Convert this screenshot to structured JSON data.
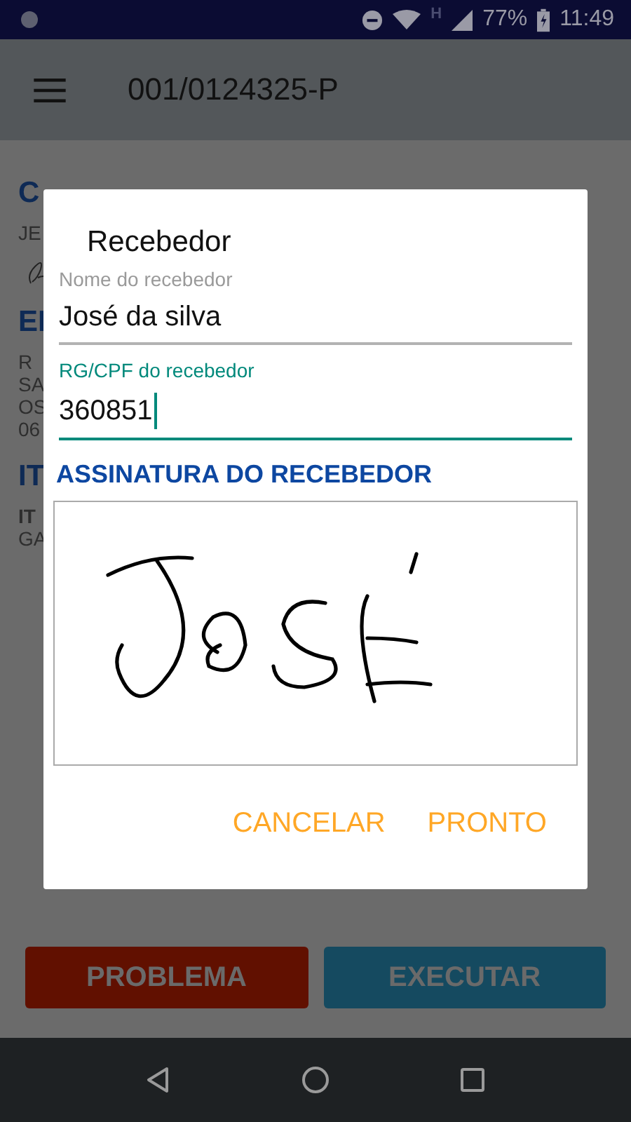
{
  "status_bar": {
    "network": "H",
    "battery": "77%",
    "time": "11:49"
  },
  "app_bar": {
    "title": "001/0124325-P"
  },
  "background": {
    "lines": [
      {
        "kind": "heading",
        "text": "C"
      },
      {
        "kind": "text",
        "text": "JE"
      },
      {
        "kind": "signature"
      },
      {
        "kind": "heading",
        "text": "EI"
      },
      {
        "kind": "text",
        "text": "R"
      },
      {
        "kind": "text",
        "text": "SA"
      },
      {
        "kind": "text",
        "text": "OS"
      },
      {
        "kind": "text",
        "text": "06"
      },
      {
        "kind": "heading",
        "text": "IT"
      },
      {
        "kind": "bold",
        "text": "IT"
      },
      {
        "kind": "text",
        "text": "GA"
      }
    ]
  },
  "dialog": {
    "title": "Recebedor",
    "fields": [
      {
        "label": "Nome do recebedor",
        "value": "José da silva",
        "focused": false
      },
      {
        "label": "RG/CPF do recebedor",
        "value": "360851",
        "focused": true
      }
    ],
    "signature_heading": "ASSINATURA DO RECEBEDOR",
    "buttons": [
      "CANCELAR",
      "PRONTO"
    ]
  },
  "actions": [
    {
      "label": "PROBLEMA",
      "kind": "danger"
    },
    {
      "label": "EXECUTAR",
      "kind": "primary"
    }
  ]
}
